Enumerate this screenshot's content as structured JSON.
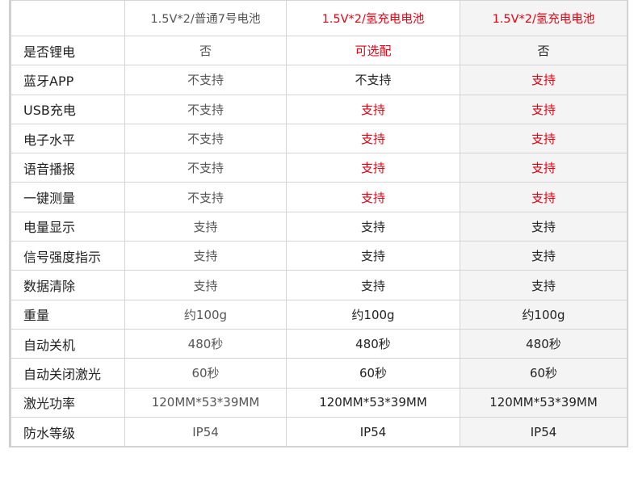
{
  "accent_red": "#e60012",
  "header": [
    "",
    "1.5V*2/普通7号电池",
    "1.5V*2/氢充电电池",
    "1.5V*2/氢充电电池"
  ],
  "header_red": [
    false,
    false,
    true,
    true
  ],
  "rows": [
    {
      "label": "是否锂电",
      "values": [
        "否",
        "可选配",
        "否"
      ],
      "red": [
        false,
        true,
        false
      ]
    },
    {
      "label": "蓝牙APP",
      "values": [
        "不支持",
        "不支持",
        "支持"
      ],
      "red": [
        false,
        false,
        true
      ]
    },
    {
      "label": "USB充电",
      "values": [
        "不支持",
        "支持",
        "支持"
      ],
      "red": [
        false,
        true,
        true
      ]
    },
    {
      "label": "电子水平",
      "values": [
        "不支持",
        "支持",
        "支持"
      ],
      "red": [
        false,
        true,
        true
      ]
    },
    {
      "label": "语音播报",
      "values": [
        "不支持",
        "支持",
        "支持"
      ],
      "red": [
        false,
        true,
        true
      ]
    },
    {
      "label": "一键测量",
      "values": [
        "不支持",
        "支持",
        "支持"
      ],
      "red": [
        false,
        true,
        true
      ]
    },
    {
      "label": "电量显示",
      "values": [
        "支持",
        "支持",
        "支持"
      ],
      "red": [
        false,
        false,
        false
      ]
    },
    {
      "label": "信号强度指示",
      "values": [
        "支持",
        "支持",
        "支持"
      ],
      "red": [
        false,
        false,
        false
      ]
    },
    {
      "label": "数据清除",
      "values": [
        "支持",
        "支持",
        "支持"
      ],
      "red": [
        false,
        false,
        false
      ]
    },
    {
      "label": "重量",
      "values": [
        "约100g",
        "约100g",
        "约100g"
      ],
      "red": [
        false,
        false,
        false
      ]
    },
    {
      "label": "自动关机",
      "values": [
        "480秒",
        "480秒",
        "480秒"
      ],
      "red": [
        false,
        false,
        false
      ]
    },
    {
      "label": "自动关闭激光",
      "values": [
        "60秒",
        "60秒",
        "60秒"
      ],
      "red": [
        false,
        false,
        false
      ]
    },
    {
      "label": "激光功率",
      "values": [
        "120MM*53*39MM",
        "120MM*53*39MM",
        "120MM*53*39MM"
      ],
      "red": [
        false,
        false,
        false
      ]
    },
    {
      "label": "防水等级",
      "values": [
        "IP54",
        "IP54",
        "IP54"
      ],
      "red": [
        false,
        false,
        false
      ]
    }
  ]
}
